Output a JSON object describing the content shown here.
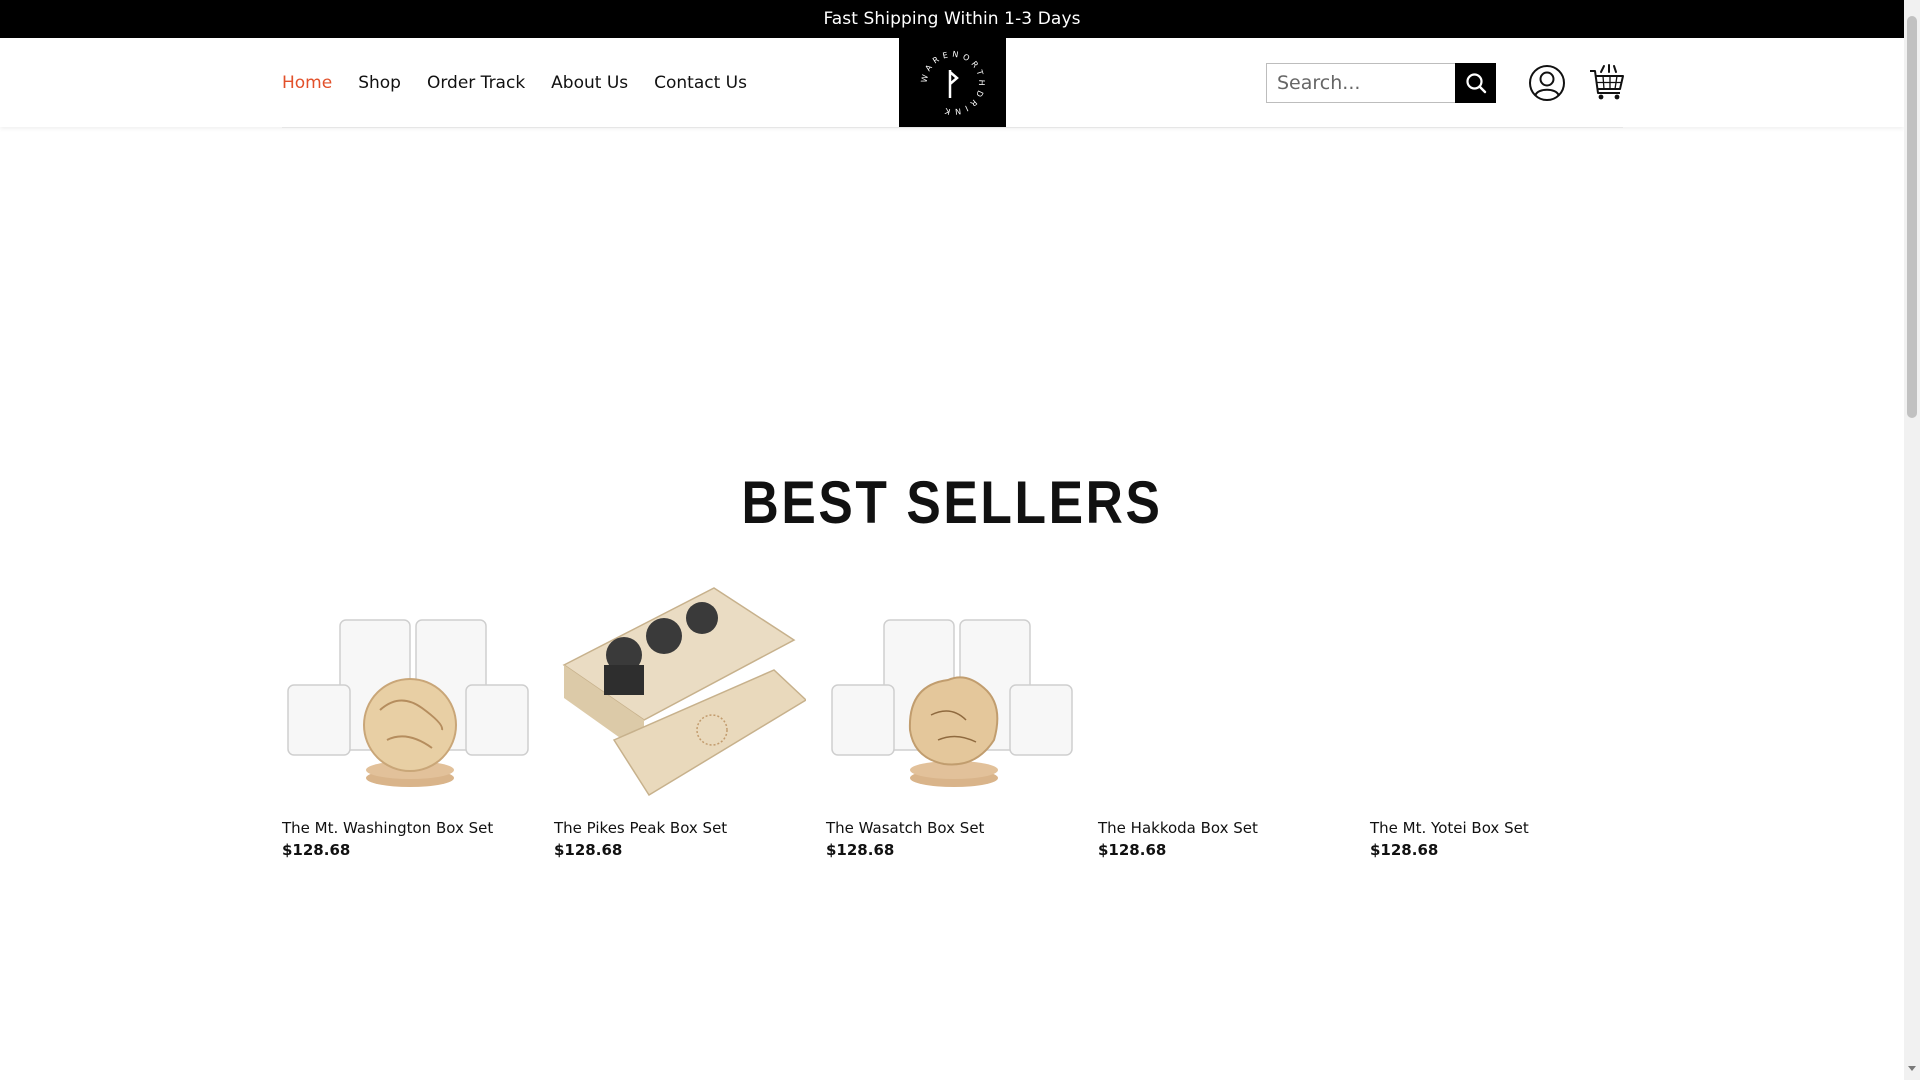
{
  "announcement": {
    "text": "Fast Shipping Within 1-3 Days"
  },
  "nav": {
    "items": [
      {
        "label": "Home",
        "active": true
      },
      {
        "label": "Shop",
        "active": false
      },
      {
        "label": "Order Track",
        "active": false
      },
      {
        "label": "About Us",
        "active": false
      },
      {
        "label": "Contact Us",
        "active": false
      }
    ]
  },
  "logo": {
    "text": "WARE NORTH DRINK",
    "icon": "rune-logo"
  },
  "search": {
    "placeholder": "Search...",
    "value": "",
    "icon": "search-icon"
  },
  "header_icons": {
    "account": "user-circle-icon",
    "cart": "shopping-cart-icon"
  },
  "colors": {
    "accent": "#e2502a",
    "announcement_bg": "#000000",
    "text": "#111111"
  },
  "best_sellers": {
    "title": "BEST SELLERS",
    "products": [
      {
        "name": "The Mt. Washington Box Set",
        "price": "$128.68",
        "image": "glasses-with-coaster"
      },
      {
        "name": "The Pikes Peak Box Set",
        "price": "$128.68",
        "image": "wooden-gift-box"
      },
      {
        "name": "The Wasatch Box Set",
        "price": "$128.68",
        "image": "glasses-with-coaster"
      },
      {
        "name": "The Hakkoda Box Set",
        "price": "$128.68",
        "image": ""
      },
      {
        "name": "The Mt. Yotei Box Set",
        "price": "$128.68",
        "image": ""
      }
    ]
  }
}
